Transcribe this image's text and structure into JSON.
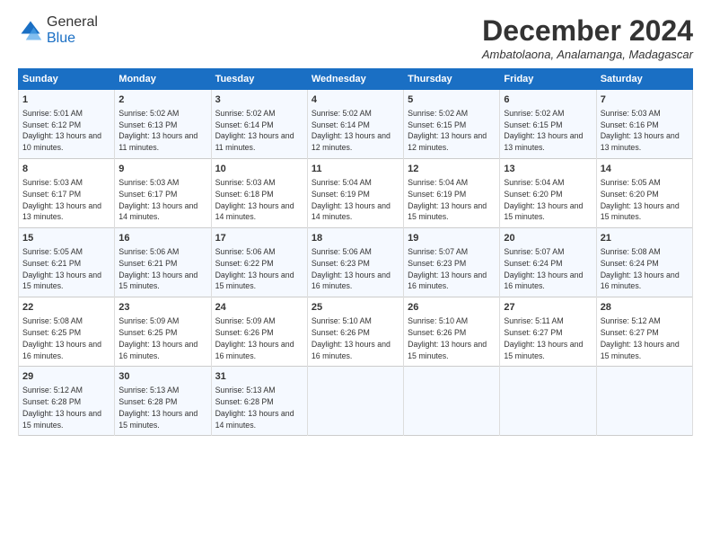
{
  "logo": {
    "general": "General",
    "blue": "Blue"
  },
  "title": "December 2024",
  "location": "Ambatolaona, Analamanga, Madagascar",
  "days_header": [
    "Sunday",
    "Monday",
    "Tuesday",
    "Wednesday",
    "Thursday",
    "Friday",
    "Saturday"
  ],
  "weeks": [
    [
      {
        "day": "1",
        "sunrise": "5:01 AM",
        "sunset": "6:12 PM",
        "daylight": "13 hours and 10 minutes."
      },
      {
        "day": "2",
        "sunrise": "5:02 AM",
        "sunset": "6:13 PM",
        "daylight": "13 hours and 11 minutes."
      },
      {
        "day": "3",
        "sunrise": "5:02 AM",
        "sunset": "6:14 PM",
        "daylight": "13 hours and 11 minutes."
      },
      {
        "day": "4",
        "sunrise": "5:02 AM",
        "sunset": "6:14 PM",
        "daylight": "13 hours and 12 minutes."
      },
      {
        "day": "5",
        "sunrise": "5:02 AM",
        "sunset": "6:15 PM",
        "daylight": "13 hours and 12 minutes."
      },
      {
        "day": "6",
        "sunrise": "5:02 AM",
        "sunset": "6:15 PM",
        "daylight": "13 hours and 13 minutes."
      },
      {
        "day": "7",
        "sunrise": "5:03 AM",
        "sunset": "6:16 PM",
        "daylight": "13 hours and 13 minutes."
      }
    ],
    [
      {
        "day": "8",
        "sunrise": "5:03 AM",
        "sunset": "6:17 PM",
        "daylight": "13 hours and 13 minutes."
      },
      {
        "day": "9",
        "sunrise": "5:03 AM",
        "sunset": "6:17 PM",
        "daylight": "13 hours and 14 minutes."
      },
      {
        "day": "10",
        "sunrise": "5:03 AM",
        "sunset": "6:18 PM",
        "daylight": "13 hours and 14 minutes."
      },
      {
        "day": "11",
        "sunrise": "5:04 AM",
        "sunset": "6:19 PM",
        "daylight": "13 hours and 14 minutes."
      },
      {
        "day": "12",
        "sunrise": "5:04 AM",
        "sunset": "6:19 PM",
        "daylight": "13 hours and 15 minutes."
      },
      {
        "day": "13",
        "sunrise": "5:04 AM",
        "sunset": "6:20 PM",
        "daylight": "13 hours and 15 minutes."
      },
      {
        "day": "14",
        "sunrise": "5:05 AM",
        "sunset": "6:20 PM",
        "daylight": "13 hours and 15 minutes."
      }
    ],
    [
      {
        "day": "15",
        "sunrise": "5:05 AM",
        "sunset": "6:21 PM",
        "daylight": "13 hours and 15 minutes."
      },
      {
        "day": "16",
        "sunrise": "5:06 AM",
        "sunset": "6:21 PM",
        "daylight": "13 hours and 15 minutes."
      },
      {
        "day": "17",
        "sunrise": "5:06 AM",
        "sunset": "6:22 PM",
        "daylight": "13 hours and 15 minutes."
      },
      {
        "day": "18",
        "sunrise": "5:06 AM",
        "sunset": "6:23 PM",
        "daylight": "13 hours and 16 minutes."
      },
      {
        "day": "19",
        "sunrise": "5:07 AM",
        "sunset": "6:23 PM",
        "daylight": "13 hours and 16 minutes."
      },
      {
        "day": "20",
        "sunrise": "5:07 AM",
        "sunset": "6:24 PM",
        "daylight": "13 hours and 16 minutes."
      },
      {
        "day": "21",
        "sunrise": "5:08 AM",
        "sunset": "6:24 PM",
        "daylight": "13 hours and 16 minutes."
      }
    ],
    [
      {
        "day": "22",
        "sunrise": "5:08 AM",
        "sunset": "6:25 PM",
        "daylight": "13 hours and 16 minutes."
      },
      {
        "day": "23",
        "sunrise": "5:09 AM",
        "sunset": "6:25 PM",
        "daylight": "13 hours and 16 minutes."
      },
      {
        "day": "24",
        "sunrise": "5:09 AM",
        "sunset": "6:26 PM",
        "daylight": "13 hours and 16 minutes."
      },
      {
        "day": "25",
        "sunrise": "5:10 AM",
        "sunset": "6:26 PM",
        "daylight": "13 hours and 16 minutes."
      },
      {
        "day": "26",
        "sunrise": "5:10 AM",
        "sunset": "6:26 PM",
        "daylight": "13 hours and 15 minutes."
      },
      {
        "day": "27",
        "sunrise": "5:11 AM",
        "sunset": "6:27 PM",
        "daylight": "13 hours and 15 minutes."
      },
      {
        "day": "28",
        "sunrise": "5:12 AM",
        "sunset": "6:27 PM",
        "daylight": "13 hours and 15 minutes."
      }
    ],
    [
      {
        "day": "29",
        "sunrise": "5:12 AM",
        "sunset": "6:28 PM",
        "daylight": "13 hours and 15 minutes."
      },
      {
        "day": "30",
        "sunrise": "5:13 AM",
        "sunset": "6:28 PM",
        "daylight": "13 hours and 15 minutes."
      },
      {
        "day": "31",
        "sunrise": "5:13 AM",
        "sunset": "6:28 PM",
        "daylight": "13 hours and 14 minutes."
      },
      null,
      null,
      null,
      null
    ]
  ]
}
